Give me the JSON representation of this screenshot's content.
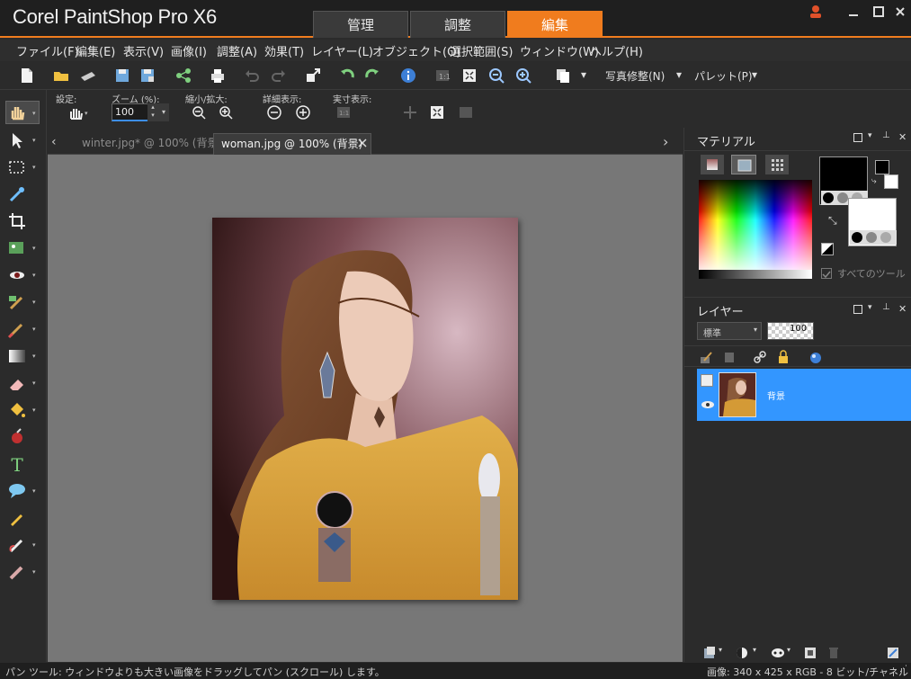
{
  "app": {
    "title": "Corel PaintShop Pro X6"
  },
  "workspace_tabs": [
    {
      "label": "管理"
    },
    {
      "label": "調整"
    },
    {
      "label": "編集"
    }
  ],
  "menu": [
    {
      "label": "ファイル(F)"
    },
    {
      "label": "編集(E)"
    },
    {
      "label": "表示(V)"
    },
    {
      "label": "画像(I)"
    },
    {
      "label": "調整(A)"
    },
    {
      "label": "効果(T)"
    },
    {
      "label": "レイヤー(L)"
    },
    {
      "label": "オブジェクト(O)"
    },
    {
      "label": "選択範囲(S)"
    },
    {
      "label": "ウィンドウ(W)"
    },
    {
      "label": "ヘルプ(H)"
    }
  ],
  "toolbar": {
    "photo_fix": "写真修整(N)",
    "palette": "パレット(P)"
  },
  "options": {
    "settings_label": "設定:",
    "zoom_label": "ズーム (%):",
    "zoom_value": "100",
    "zoom_inout_label": "縮小/拡大:",
    "detail_label": "詳細表示:",
    "actual_label": "実寸表示:"
  },
  "doc_tabs": [
    {
      "label": "winter.jpg* @ 100% (背景)"
    },
    {
      "label": "woman.jpg @ 100% (背景)"
    }
  ],
  "materials": {
    "title": "マテリアル",
    "all_tools": "すべてのツール"
  },
  "layers": {
    "title": "レイヤー",
    "blend_mode": "標準",
    "opacity": "100",
    "items": [
      {
        "name": "背景"
      }
    ]
  },
  "status": {
    "left": "パン ツール: ウィンドウよりも大きい画像をドラッグしてパン (スクロール) します。",
    "right": "画像:  340 x 425 x RGB - 8 ビット/チャネル"
  }
}
